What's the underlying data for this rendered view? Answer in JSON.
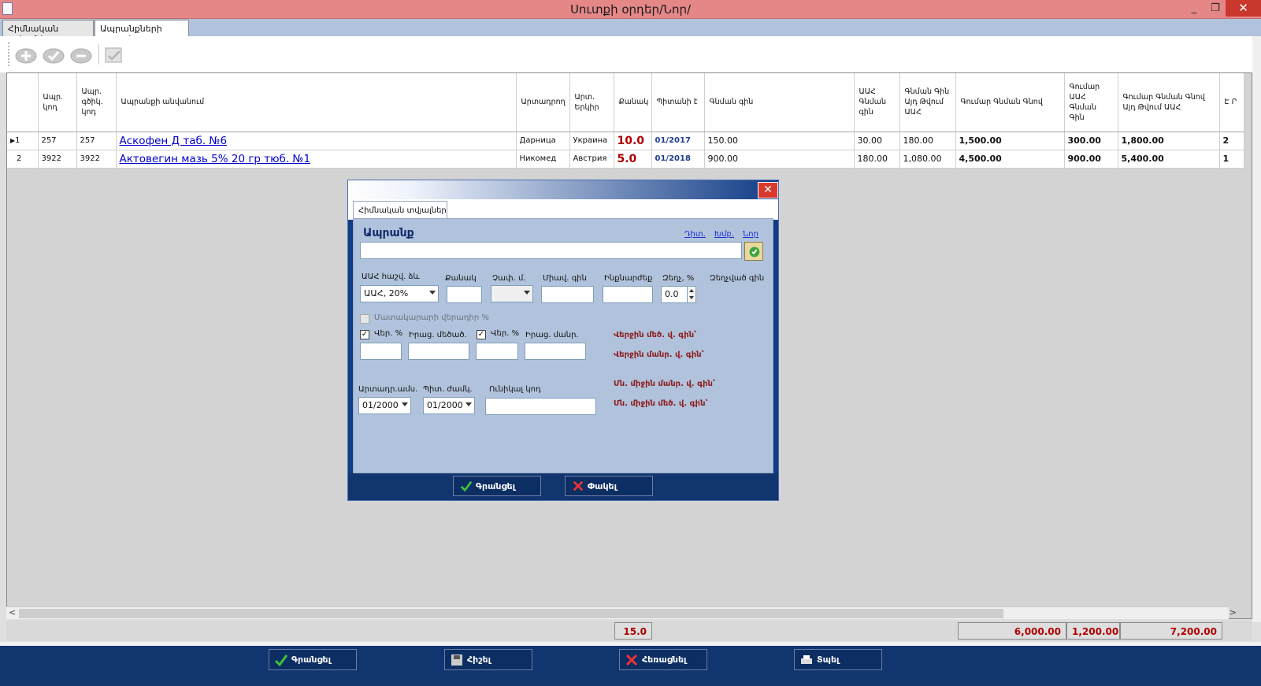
{
  "window": {
    "title": "Սուտքի օրդեր/Նոր/",
    "min": "_",
    "max": "❐",
    "close": "✕"
  },
  "tabs": [
    "Հիմնական տվյալներ",
    "Ապրանքների ցուցակ"
  ],
  "grid": {
    "headers": [
      "",
      "Ապր. կոդ",
      "Ապր. գծիկ. կոդ",
      "Ապրանքի անվանում",
      "Արտադրող",
      "Արտ. Երկիր",
      "Քանակ",
      "Պիտանի է",
      "Գնման գին",
      "ԱԱՀ Գնման գին",
      "Գնման Գին Այդ Թվում ԱԱՀ",
      "Գումար Գնման Գնով",
      "Գումար ԱԱՀ Գնման Գին",
      "Գումար Գնման Գնով Այդ Թվում ԱԱՀ",
      "Է Ր"
    ],
    "rows": [
      {
        "n": "1",
        "marker": "▶",
        "code": "257",
        "bar": "257",
        "name": "Аскофен Д таб. №6",
        "maker": "Дарница",
        "country": "Украина",
        "qty": "10.0",
        "exp": "01/2017",
        "price": "150.00",
        "vat": "30.00",
        "pvat": "180.00",
        "sum": "1,500.00",
        "sumvat": "300.00",
        "sumtotal": "1,800.00",
        "extra": "2"
      },
      {
        "n": "2",
        "marker": "",
        "code": "3922",
        "bar": "3922",
        "name": "Актовегин мазь 5% 20 гр тюб. №1",
        "maker": "Никомед",
        "country": "Австрия",
        "qty": "5.0",
        "exp": "01/2018",
        "price": "900.00",
        "vat": "180.00",
        "pvat": "1,080.00",
        "sum": "4,500.00",
        "sumvat": "900.00",
        "sumtotal": "5,400.00",
        "extra": "1"
      }
    ]
  },
  "totals": {
    "qty": "15.0",
    "sum": "6,000.00",
    "vat": "1,200.00",
    "total": "7,200.00"
  },
  "bottom": {
    "save": "Գրանցել",
    "print": "Հիշել",
    "cancel": "Հեռացնել",
    "exit": "Տպել"
  },
  "dialog": {
    "tab": "Հիմնական տվյալներ",
    "heading": "Ապրանք",
    "links": [
      "Դիտ.",
      "Խմբ.",
      "Նոր"
    ],
    "product_value": "",
    "labels": {
      "vat_calc": "ԱԱՀ հաշվ. ձև",
      "qty": "Քանակ",
      "unit": "Չափ. մ.",
      "unit_price": "Միավ. գին",
      "cost": "Ինքնարժեք",
      "discount": "Զեղչ, %",
      "discounted": "Զեղչված գին",
      "supplier_markup": "Մատակարարի վերադիր %",
      "ver1": "Վեր. %",
      "retail_mid": "Իրաց. մեծած.",
      "ver2": "Վեր. %",
      "retail_small": "Իրաց. մանր.",
      "prod_date": "Արտադր.ամս.",
      "exp_date": "Պիտ. ժամկ.",
      "unique_code": "Ունիկալ կոդ"
    },
    "values": {
      "vat_calc": "ԱԱՀ, 20%",
      "discount": "0.0",
      "prod_date": "01/2000",
      "exp_date": "01/2000"
    },
    "info": [
      "Վերջին մեծ. վ. գին՝",
      "Վերջին մանր. վ. գին՝",
      "Մն. միջին մանր. վ. գին՝",
      "Մն. միջին մեծ. վ. գին՝"
    ],
    "buttons": {
      "save": "Գրանցել",
      "close": "Փակել"
    }
  }
}
